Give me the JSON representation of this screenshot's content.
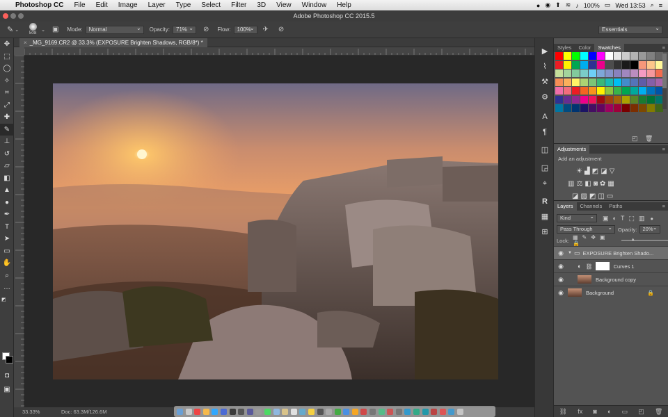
{
  "menubar": {
    "app_name": "Photoshop CC",
    "items": [
      "File",
      "Edit",
      "Image",
      "Layer",
      "Type",
      "Select",
      "Filter",
      "3D",
      "View",
      "Window",
      "Help"
    ],
    "battery": "100%",
    "clock": "Wed 13:53"
  },
  "window_title": "Adobe Photoshop CC 2015.5",
  "options_bar": {
    "brush_size": "508",
    "mode_label": "Mode:",
    "mode_value": "Normal",
    "opacity_label": "Opacity:",
    "opacity_value": "71%",
    "flow_label": "Flow:",
    "flow_value": "100%",
    "workspace": "Essentials"
  },
  "document": {
    "tab_title": "_MG_9169.CR2 @ 33.3% (EXPOSURE Brighten Shadows, RGB/8*) *",
    "zoom": "33.33%",
    "doc_size": "Doc: 63.3M/126.6M"
  },
  "panels": {
    "swatch_tabs": [
      "Styles",
      "Color",
      "Swatches"
    ],
    "adjustments_title": "Adjustments",
    "adjustments_hint": "Add an adjustment",
    "layer_tabs": [
      "Layers",
      "Channels",
      "Paths"
    ],
    "filter_kind": "Kind",
    "blend_mode": "Pass Through",
    "opacity_label": "Opacity:",
    "opacity_value": "20%",
    "lock_label": "Lock:"
  },
  "layers": [
    {
      "name": "EXPOSURE Brighten Shado...",
      "type": "group"
    },
    {
      "name": "Curves 1",
      "type": "adjustment"
    },
    {
      "name": "Background copy",
      "type": "image"
    },
    {
      "name": "Background",
      "type": "image",
      "locked": true
    }
  ],
  "swatch_colors": [
    "#ff0000",
    "#ffff00",
    "#00ff00",
    "#00ffff",
    "#0000ff",
    "#ff00ff",
    "#ffffff",
    "#e6e6e6",
    "#cccccc",
    "#b3b3b3",
    "#999999",
    "#808080",
    "#666666",
    "#ed1c24",
    "#fff200",
    "#00a651",
    "#00aeef",
    "#2e3192",
    "#ec008c",
    "#4d4d4d",
    "#333333",
    "#1a1a1a",
    "#000000",
    "#f7977a",
    "#fdc68a",
    "#fff79a",
    "#c4df9b",
    "#a3d39c",
    "#82ca9d",
    "#7bcdc8",
    "#6ecff6",
    "#7ea7d8",
    "#8493ca",
    "#8882be",
    "#a187be",
    "#bc8dbf",
    "#f49ac2",
    "#f6989d",
    "#f26c4f",
    "#f68e55",
    "#fbaf5c",
    "#fff467",
    "#acd372",
    "#7cc576",
    "#3bb878",
    "#1abbb4",
    "#00bff3",
    "#438ccb",
    "#5574b9",
    "#605ca8",
    "#855fa8",
    "#a763a8",
    "#f06ea9",
    "#f26d7d",
    "#ed1c24",
    "#f26522",
    "#f7941d",
    "#fff200",
    "#8dc63f",
    "#39b54a",
    "#00a651",
    "#00a99d",
    "#00aeef",
    "#0072bc",
    "#0054a6",
    "#2e3192",
    "#662d91",
    "#92278f",
    "#ec008c",
    "#ed145b",
    "#9e0b0f",
    "#a0410d",
    "#a36209",
    "#aba000",
    "#598527",
    "#1a7b30",
    "#007236",
    "#00746b",
    "#0076a3",
    "#004b80",
    "#003471",
    "#1b1464",
    "#440e62",
    "#630460",
    "#9e005d",
    "#9e0039",
    "#790000",
    "#7b2e00",
    "#7d4900",
    "#827b00",
    "#406618"
  ]
}
